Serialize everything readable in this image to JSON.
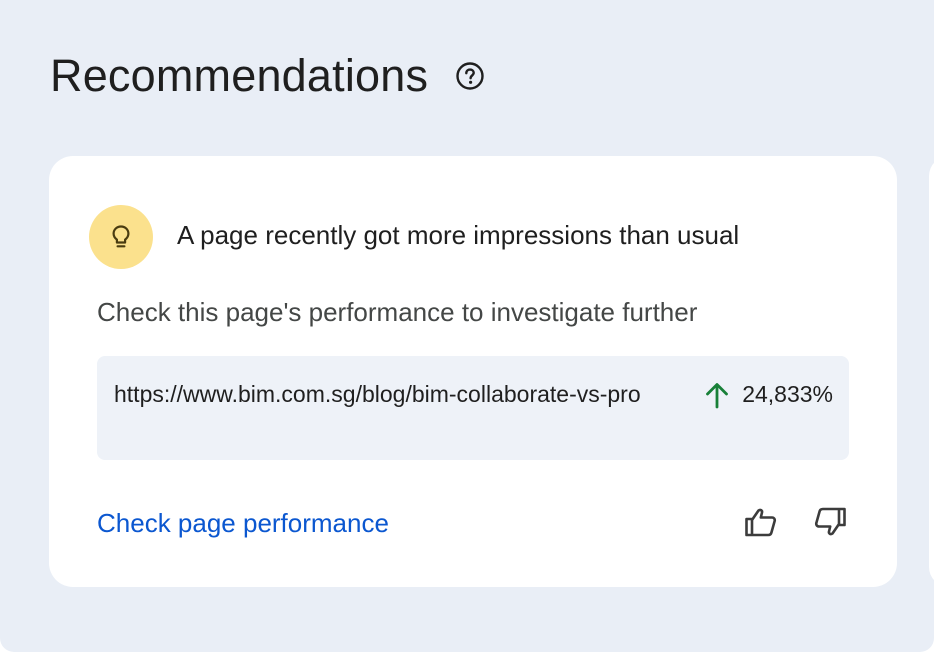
{
  "section": {
    "title": "Recommendations",
    "help_icon": "help-circle-icon"
  },
  "card": {
    "icon": "lightbulb-icon",
    "icon_badge_color": "#fbe18d",
    "title": "A page recently got more impressions than usual",
    "description": "Check this page's performance to investigate further",
    "url": "https://www.bim.com.sg/blog/bim-collaborate-vs-pro",
    "metric": {
      "direction_icon": "arrow-up-icon",
      "value": "24,833%",
      "color": "#188038"
    },
    "action_label": "Check page performance",
    "feedback": {
      "like_icon": "thumb-up-icon",
      "dislike_icon": "thumb-down-icon"
    }
  },
  "colors": {
    "background": "#e9eef6",
    "card": "#ffffff",
    "link": "#0b57d0"
  }
}
